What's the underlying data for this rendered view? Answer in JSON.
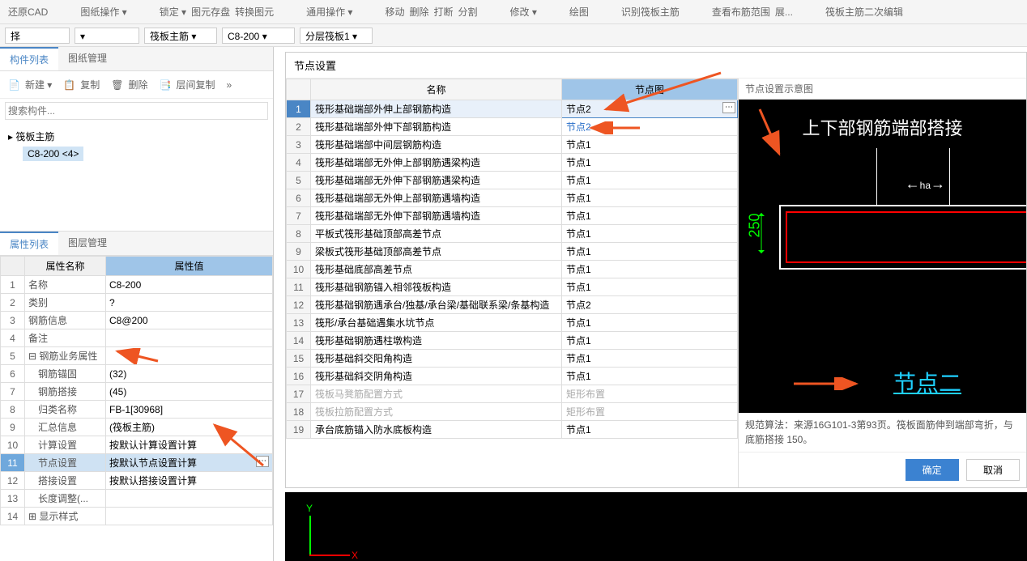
{
  "toolbar": {
    "cad": "还原CAD",
    "paper": "图纸操作 ▾",
    "lock": "锁定 ▾",
    "layer": "图元存盘",
    "convert": "转换图元",
    "move": "移动",
    "del": "删除",
    "break": "打断",
    "split": "分割",
    "general": "通用操作 ▾",
    "edit": "修改 ▾",
    "draw": "绘图",
    "recog": "识别筏板主筋",
    "scope": "查看布筋范围",
    "scope2": "展...",
    "secondedit": "筏板主筋二次编辑"
  },
  "dropdowns": {
    "d1": "择",
    "d2": "",
    "d3": "筏板主筋",
    "d4": "C8-200",
    "d5": "分层筏板1"
  },
  "left": {
    "tab1": "构件列表",
    "tab2": "图纸管理",
    "tab3": "属性列表",
    "tab4": "图层管理",
    "new": "新建 ▾",
    "copy": "复制",
    "delete": "删除",
    "intercopy": "层间复制",
    "search_ph": "搜索构件...",
    "tree_root": "▸ 筏板主筋",
    "tree_child": "C8-200 <4>",
    "col_name": "属性名称",
    "col_val": "属性值",
    "rows": [
      {
        "n": "1",
        "name": "名称",
        "v": "C8-200",
        "blue": true
      },
      {
        "n": "2",
        "name": "类别",
        "v": "?"
      },
      {
        "n": "3",
        "name": "钢筋信息",
        "v": "C8@200",
        "blue": true
      },
      {
        "n": "4",
        "name": "备注",
        "v": ""
      },
      {
        "n": "5",
        "name": "钢筋业务属性",
        "v": "",
        "group": true
      },
      {
        "n": "6",
        "name": "钢筋锚固",
        "v": "(32)",
        "indent": true
      },
      {
        "n": "7",
        "name": "钢筋搭接",
        "v": "(45)",
        "indent": true
      },
      {
        "n": "8",
        "name": "归类名称",
        "v": "FB-1[30968]",
        "indent": true
      },
      {
        "n": "9",
        "name": "汇总信息",
        "v": "(筏板主筋)",
        "indent": true
      },
      {
        "n": "10",
        "name": "计算设置",
        "v": "按默认计算设置计算",
        "indent": true
      },
      {
        "n": "11",
        "name": "节点设置",
        "v": "按默认节点设置计算",
        "indent": true,
        "sel": true,
        "btn": true
      },
      {
        "n": "12",
        "name": "搭接设置",
        "v": "按默认搭接设置计算",
        "indent": true
      },
      {
        "n": "13",
        "name": "长度调整(...",
        "v": "",
        "indent": true
      },
      {
        "n": "14",
        "name": "显示样式",
        "v": "",
        "group": true,
        "plus": true
      }
    ]
  },
  "dialog": {
    "title": "节点设置",
    "col_name": "名称",
    "col_node": "节点图",
    "rows": [
      {
        "n": "1",
        "name": "筏形基础端部外伸上部钢筋构造",
        "v": "节点2",
        "sel": true,
        "edit": true
      },
      {
        "n": "2",
        "name": "筏形基础端部外伸下部钢筋构造",
        "v": "节点2",
        "blue": true
      },
      {
        "n": "3",
        "name": "筏形基础端部中间层钢筋构造",
        "v": "节点1"
      },
      {
        "n": "4",
        "name": "筏形基础端部无外伸上部钢筋遇梁构造",
        "v": "节点1"
      },
      {
        "n": "5",
        "name": "筏形基础端部无外伸下部钢筋遇梁构造",
        "v": "节点1"
      },
      {
        "n": "6",
        "name": "筏形基础端部无外伸上部钢筋遇墙构造",
        "v": "节点1"
      },
      {
        "n": "7",
        "name": "筏形基础端部无外伸下部钢筋遇墙构造",
        "v": "节点1"
      },
      {
        "n": "8",
        "name": "平板式筏形基础顶部高差节点",
        "v": "节点1"
      },
      {
        "n": "9",
        "name": "梁板式筏形基础顶部高差节点",
        "v": "节点1"
      },
      {
        "n": "10",
        "name": "筏形基础底部高差节点",
        "v": "节点1"
      },
      {
        "n": "11",
        "name": "筏形基础钢筋锚入相邻筏板构造",
        "v": "节点1"
      },
      {
        "n": "12",
        "name": "筏形基础钢筋遇承台/独基/承台梁/基础联系梁/条基构造",
        "v": "节点2"
      },
      {
        "n": "13",
        "name": "筏形/承台基础遇集水坑节点",
        "v": "节点1"
      },
      {
        "n": "14",
        "name": "筏形基础钢筋遇柱墩构造",
        "v": "节点1"
      },
      {
        "n": "15",
        "name": "筏形基础斜交阳角构造",
        "v": "节点1"
      },
      {
        "n": "16",
        "name": "筏形基础斜交阴角构造",
        "v": "节点1"
      },
      {
        "n": "17",
        "name": "筏板马凳筋配置方式",
        "v": "矩形布置",
        "gray": true
      },
      {
        "n": "18",
        "name": "筏板拉筋配置方式",
        "v": "矩形布置",
        "gray": true
      },
      {
        "n": "19",
        "name": "承台底筋锚入防水底板构造",
        "v": "节点1"
      }
    ],
    "preview_title": "节点设置示意图",
    "pv_title": "上下部钢筋端部搭接",
    "pv_ha": "ha",
    "pv_250": "250",
    "pv_node": "节点二",
    "caption": "规范算法：来源16G101-3第93页。筏板面筋伸到端部弯折，与底筋搭接 150。",
    "ok": "确定",
    "cancel": "取消"
  },
  "axis": {
    "x": "X",
    "y": "Y"
  }
}
